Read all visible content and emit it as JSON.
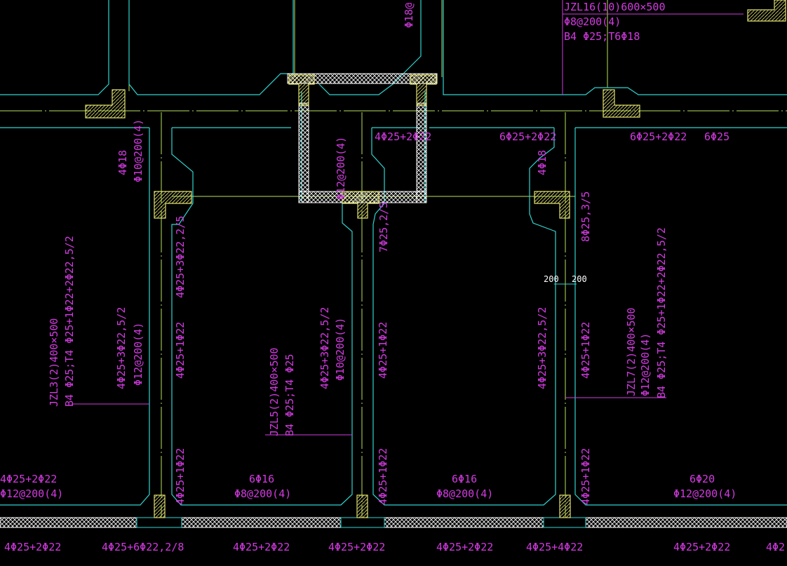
{
  "colors": {
    "background": "#000000",
    "beam_outline": "#2fd4cf",
    "axis_line": "#b8e05a",
    "column_fill": "#e0e070",
    "annotation": "#d23be0",
    "dimension": "#ffffff",
    "hatch_wall": "#ffffff"
  },
  "labels": {
    "top_jzl16_1": "JZL16(10)600×500",
    "top_jzl16_2": "Φ8@200(4)",
    "top_jzl16_3": "B4 Φ25;T6Φ18",
    "top_stirrup_v": "Φ18@",
    "r1_a": "4Φ25+2Φ22",
    "r1_b": "6Φ25+2Φ22",
    "r1_c": "6Φ25+2Φ22",
    "r1_d": "6Φ25",
    "v_4phi18_left": "4Φ18",
    "v_stirrup_left": "Φ10@200(4)",
    "v_stirrup_core": "Φ12@200(4)",
    "v_4phi18_right": "4Φ18",
    "v_a1": "4Φ25+3Φ22,2/5",
    "v_a2": "7Φ25,2/5",
    "v_a3": "8Φ25,3/5",
    "dim_left": "200",
    "dim_right": "200",
    "jzl3_1": "JZL3(2)400×500",
    "jzl3_2": "B4 Φ25;T4 Φ25+1Φ22+2Φ22,5/2",
    "beam1_1": "4Φ25+3Φ22,5/2",
    "beam1_2": "Φ12@200(4)",
    "mid_1": "4Φ25+1Φ22",
    "jzl5_1": "JZL5(2)400×500",
    "jzl5_2": "B4 Φ25;T4 Φ25",
    "beam2_1": "4Φ25+3Φ22,5/2",
    "beam2_2": "Φ10@200(4)",
    "mid_2": "4Φ25+1Φ22",
    "beam3_1": "4Φ25+3Φ22,5/2",
    "mid_3": "4Φ25+1Φ22",
    "jzl7_1": "JZL7(2)400×500",
    "jzl7_2": "Φ12@200(4)",
    "jzl7_3": "B4 Φ25;T4 Φ25+1Φ22+2Φ22,5/2",
    "low_1": "4Φ25+1Φ22",
    "low_2": "4Φ25+1Φ22",
    "low_3": "4Φ25+1Φ22",
    "bl_1": "4Φ25+2Φ22",
    "bl_2": "Φ12@200(4)",
    "b6a_1": "6Φ16",
    "b6a_2": "Φ8@200(4)",
    "b6b_1": "6Φ16",
    "b6b_2": "Φ8@200(4)",
    "b6c_1": "6Φ20",
    "b6c_2": "Φ12@200(4)",
    "bottom_1": "4Φ25+2Φ22",
    "bottom_2": "4Φ25+6Φ22,2/8",
    "bottom_3": "4Φ25+2Φ22",
    "bottom_4": "4Φ25+2Φ22",
    "bottom_5": "4Φ25+2Φ22",
    "bottom_6": "4Φ25+4Φ22",
    "bottom_7": "4Φ25+2Φ22",
    "bottom_8": "4Φ2"
  }
}
